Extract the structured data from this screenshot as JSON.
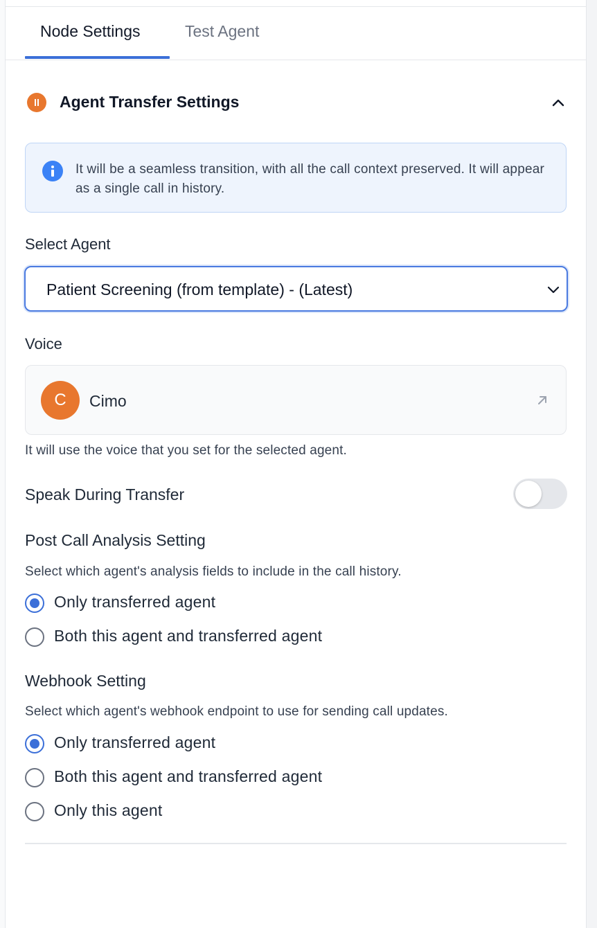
{
  "tabs": {
    "node_settings": "Node Settings",
    "test_agent": "Test Agent"
  },
  "section": {
    "title": "Agent Transfer Settings",
    "icon": "pause-circle-icon"
  },
  "info": {
    "text": "It will be a seamless transition, with all the call context preserved. It will appear as a single call in history."
  },
  "select_agent": {
    "label": "Select Agent",
    "value": "Patient Screening (from template) - (Latest)"
  },
  "voice": {
    "label": "Voice",
    "avatar_initial": "C",
    "name": "Cimo",
    "helper": "It will use the voice that you set for the selected agent."
  },
  "speak_during_transfer": {
    "label": "Speak During Transfer",
    "enabled": false
  },
  "post_call_analysis": {
    "title": "Post Call Analysis Setting",
    "description": "Select which agent's analysis fields to include in the call history.",
    "options": [
      {
        "label": "Only transferred agent",
        "checked": true
      },
      {
        "label": "Both this agent and transferred agent",
        "checked": false
      }
    ]
  },
  "webhook": {
    "title": "Webhook Setting",
    "description": "Select which agent's webhook endpoint to use for sending call updates.",
    "options": [
      {
        "label": "Only transferred agent",
        "checked": true
      },
      {
        "label": "Both this agent and transferred agent",
        "checked": false
      },
      {
        "label": "Only this agent",
        "checked": false
      }
    ]
  },
  "colors": {
    "accent": "#3b6fd8",
    "node_orange": "#e8772e",
    "info_bg": "#eef4fd"
  }
}
